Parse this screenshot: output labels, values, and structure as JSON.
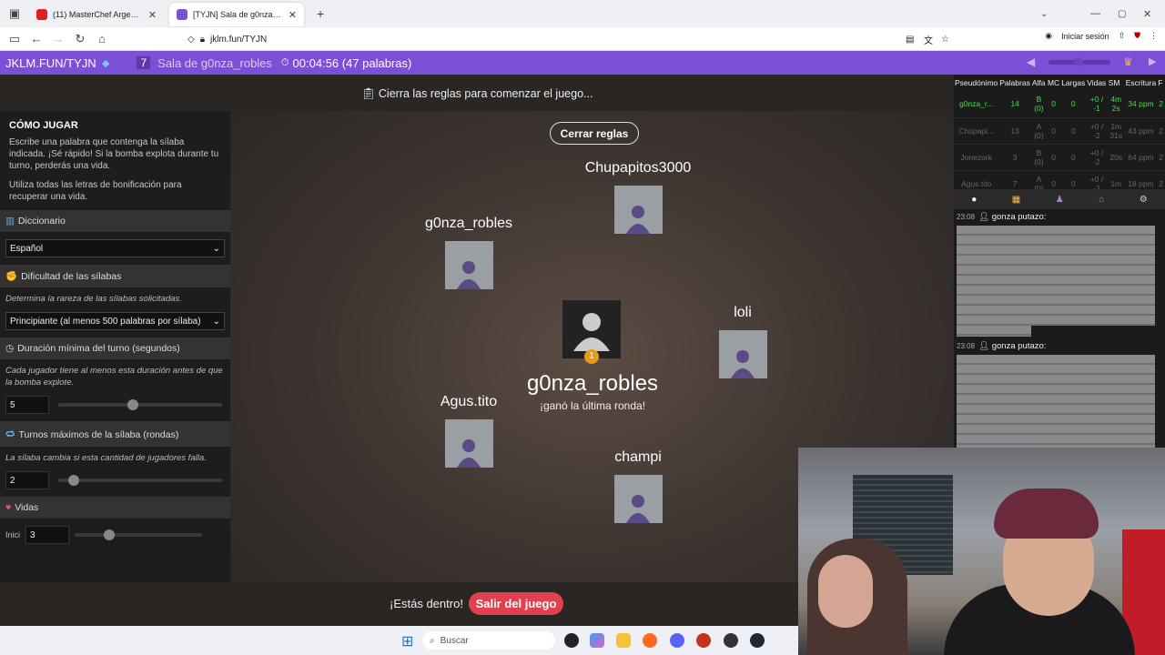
{
  "browser": {
    "tabs": [
      {
        "label": "(11) MasterChef Argentina - Yo",
        "active": false,
        "color": "#e02020"
      },
      {
        "label": "[TYJN] Sala de g0nza_robles",
        "active": true,
        "color": "#7b4fd6"
      }
    ],
    "new_tab": "+",
    "url": "jklm.fun/TYJN",
    "signin": "Iniciar sesión"
  },
  "gamebar": {
    "brand": "JKLM.FUN/TYJN",
    "room_num": "7",
    "room_name": "Sala de g0nza_robles",
    "timer": "00:04:56 (47 palabras)"
  },
  "settings": {
    "how_title": "CÓMO JUGAR",
    "how_p1": "Escribe una palabra que contenga la sílaba indicada. ¡Sé rápido! Si la bomba explota durante tu turno, perderás una vida.",
    "how_p2": "Utiliza todas las letras de bonificación para recuperar una vida.",
    "dict_label": "Diccionario",
    "dict_value": "Español",
    "diff_label": "Dificultad de las sílabas",
    "diff_help": "Determina la rareza de las sílabas solicitadas.",
    "diff_value": "Principiante (al menos 500 palabras por sílaba)",
    "dur_label": "Duración mínima del turno (segundos)",
    "dur_help": "Cada jugador tiene al menos esta duración antes de que la bomba explote.",
    "dur_value": "5",
    "turns_label": "Turnos máximos de la sílaba (rondas)",
    "turns_help": "La sílaba cambia si esta cantidad de jugadores falla.",
    "turns_value": "2",
    "lives_label": "Vidas",
    "lives_value": "3",
    "lives_sub": "Inici"
  },
  "game": {
    "rules_note": "Cierra las reglas para comenzar el juego...",
    "close_rules": "Cerrar reglas",
    "players": [
      "Chupapitos3000",
      "g0nza_robles",
      "loli",
      "Agus.tito",
      "champi"
    ],
    "winner_name": "g0nza_robles",
    "winner_sub": "¡ganó la última ronda!",
    "medal": "1",
    "joined": "¡Estás dentro!",
    "leave": "Salir del juego"
  },
  "scoreboard": {
    "headers": [
      "Pseudónimo",
      "Palabras",
      "Alfa",
      "MC",
      "Largas",
      "Vidas",
      "SM",
      "Escritura",
      "F"
    ],
    "rows": [
      [
        "g0nza_r...",
        "14",
        "B (0)",
        "0",
        "0",
        "+0 / -1",
        "4m 2s",
        "34 ppm",
        "2"
      ],
      [
        "Chupapi...",
        "13",
        "A (0)",
        "0",
        "0",
        "+0 / -2",
        "1m 31s",
        "43 ppm",
        "2"
      ],
      [
        "Jonezork",
        "3",
        "B (0)",
        "0",
        "0",
        "+0 / -2",
        "20s",
        "64 ppm",
        "2"
      ],
      [
        "Agus.tito",
        "7",
        "A (0)",
        "0",
        "0",
        "+0 / -2",
        "1m",
        "18 ppm",
        "2"
      ]
    ]
  },
  "chat": {
    "time1": "23:08",
    "user1": "gonza putazo:",
    "time2": "23:08",
    "user2": "gonza putazo:"
  },
  "taskbar": {
    "search": "Buscar"
  }
}
